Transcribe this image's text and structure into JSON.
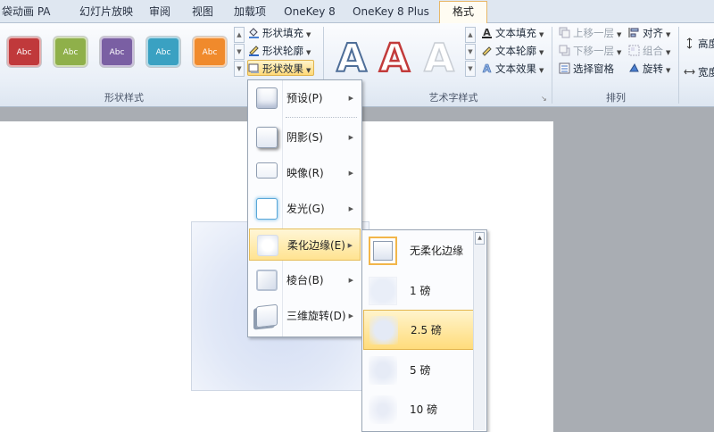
{
  "tabs": [
    {
      "label": "袋动画 PA"
    },
    {
      "label": "幻灯片放映"
    },
    {
      "label": "审阅"
    },
    {
      "label": "视图"
    },
    {
      "label": "加载项"
    },
    {
      "label": "OneKey 8"
    },
    {
      "label": "OneKey 8 Plus"
    },
    {
      "label": "格式"
    }
  ],
  "shape_styles": {
    "group_label": "形状样式",
    "swatches": [
      {
        "label": "Abc",
        "color": "#c0393b"
      },
      {
        "label": "Abc",
        "color": "#8fb04a"
      },
      {
        "label": "Abc",
        "color": "#7a5fa3"
      },
      {
        "label": "Abc",
        "color": "#3aa1c2"
      },
      {
        "label": "Abc",
        "color": "#f08a2c"
      }
    ],
    "fill_label": "形状填充",
    "outline_label": "形状轮廓",
    "effects_label": "形状效果"
  },
  "wordart": {
    "group_label": "艺术字样式",
    "glyph": "A",
    "text_fill_label": "文本填充",
    "text_outline_label": "文本轮廓",
    "text_effects_label": "文本效果"
  },
  "arrange": {
    "group_label": "排列",
    "bring_forward": "上移一层",
    "send_backward": "下移一层",
    "selection_pane": "选择窗格",
    "align": "对齐",
    "group": "组合",
    "rotate": "旋转"
  },
  "size": {
    "height_label": "高度",
    "width_label": "宽度"
  },
  "effects_menu": {
    "items": [
      {
        "label": "预设(P)"
      },
      {
        "label": "阴影(S)"
      },
      {
        "label": "映像(R)"
      },
      {
        "label": "发光(G)"
      },
      {
        "label": "柔化边缘(E)"
      },
      {
        "label": "棱台(B)"
      },
      {
        "label": "三维旋转(D)"
      }
    ]
  },
  "soft_edges_menu": {
    "items": [
      {
        "label": "无柔化边缘"
      },
      {
        "label": "1 磅"
      },
      {
        "label": "2.5 磅"
      },
      {
        "label": "5 磅"
      },
      {
        "label": "10 磅"
      }
    ],
    "selected": "2.5 磅"
  },
  "colors": {
    "highlight": "#ffe391",
    "slide_shape": "#d3ddf3"
  }
}
